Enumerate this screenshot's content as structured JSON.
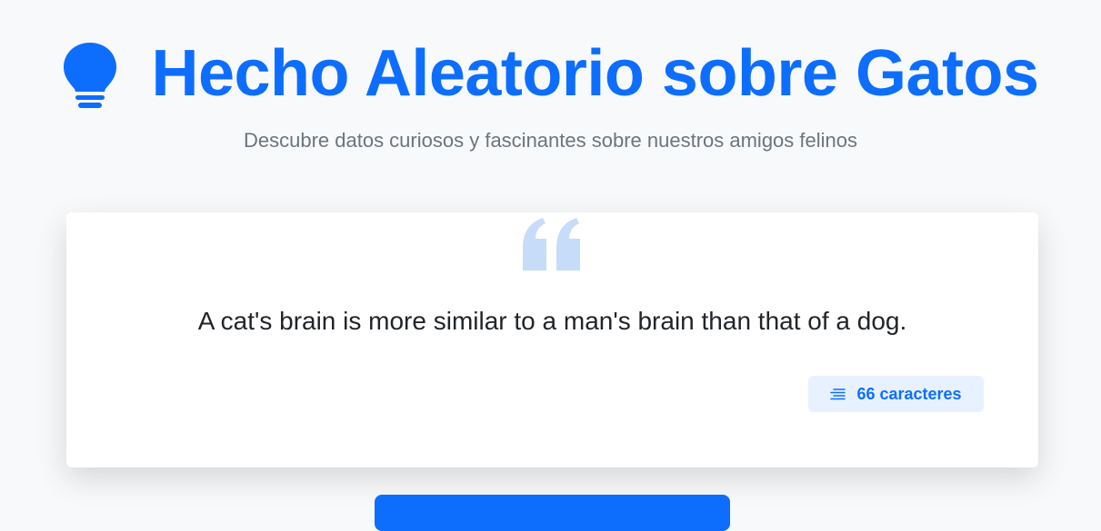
{
  "header": {
    "icon": "lightbulb-icon",
    "title": "Hecho Aleatorio sobre Gatos",
    "subtitle": "Descubre datos curiosos y fascinantes sobre nuestros amigos felinos"
  },
  "card": {
    "quote_icon": "quote-icon",
    "fact": "A cat's brain is more similar to a man's brain than that of a dog.",
    "badge": {
      "icon": "text-lines-icon",
      "label": "66 caracteres"
    }
  },
  "colors": {
    "primary": "#0d6efd",
    "quote": "#c7dcf9",
    "badge_bg": "#e7f1ff",
    "background": "#f8f9fa",
    "subtitle": "#6c757d"
  }
}
